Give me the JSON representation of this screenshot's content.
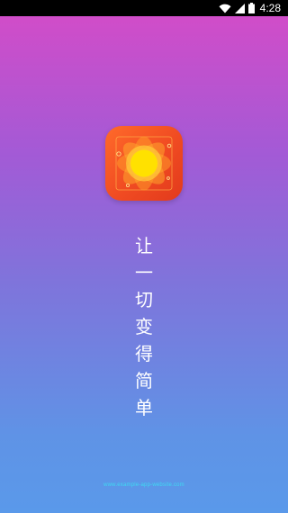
{
  "status_bar": {
    "time": "4:28",
    "icons": [
      "wifi-icon",
      "signal-icon",
      "battery-icon"
    ]
  },
  "splash": {
    "app_icon": "sunflower-app-icon",
    "slogan": [
      "让",
      "一",
      "切",
      "变",
      "得",
      "简",
      "单"
    ],
    "footer": "www.example-app-website.com"
  },
  "colors": {
    "gradient_top": "#d64bc7",
    "gradient_bottom": "#5a99ea",
    "icon_background": "#f04b22",
    "sun_core": "#ffe100",
    "footer_text": "#3fd9f0"
  }
}
